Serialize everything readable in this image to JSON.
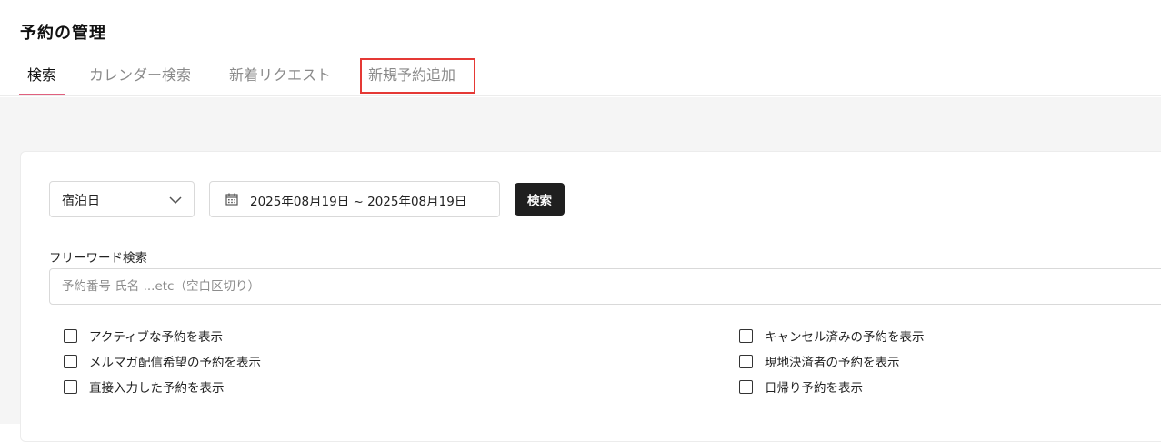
{
  "page": {
    "title": "予約の管理"
  },
  "tabs": [
    {
      "label": "検索",
      "active": true
    },
    {
      "label": "カレンダー検索",
      "active": false
    },
    {
      "label": "新着リクエスト",
      "active": false
    },
    {
      "label": "新規予約追加",
      "active": false,
      "highlighted": true
    }
  ],
  "search": {
    "date_type": {
      "selected": "宿泊日",
      "icon": "chevron-down-icon"
    },
    "date_range": {
      "value": "2025年08月19日 ~ 2025年08月19日",
      "icon": "calendar-icon"
    },
    "search_button": "検索",
    "free_word": {
      "label": "フリーワード検索",
      "value": "",
      "placeholder": "予約番号 氏名 ...etc（空白区切り）"
    }
  },
  "filters": {
    "left": [
      {
        "label": "アクティブな予約を表示",
        "checked": false
      },
      {
        "label": "メルマガ配信希望の予約を表示",
        "checked": false
      },
      {
        "label": "直接入力した予約を表示",
        "checked": false
      }
    ],
    "right": [
      {
        "label": "キャンセル済みの予約を表示",
        "checked": false
      },
      {
        "label": "現地決済者の予約を表示",
        "checked": false
      },
      {
        "label": "日帰り予約を表示",
        "checked": false
      }
    ]
  },
  "colors": {
    "active_tab_underline": "#e0607e",
    "highlight_border": "#e53935",
    "primary_button": "#1f1f1f",
    "content_background": "#f5f5f5"
  }
}
